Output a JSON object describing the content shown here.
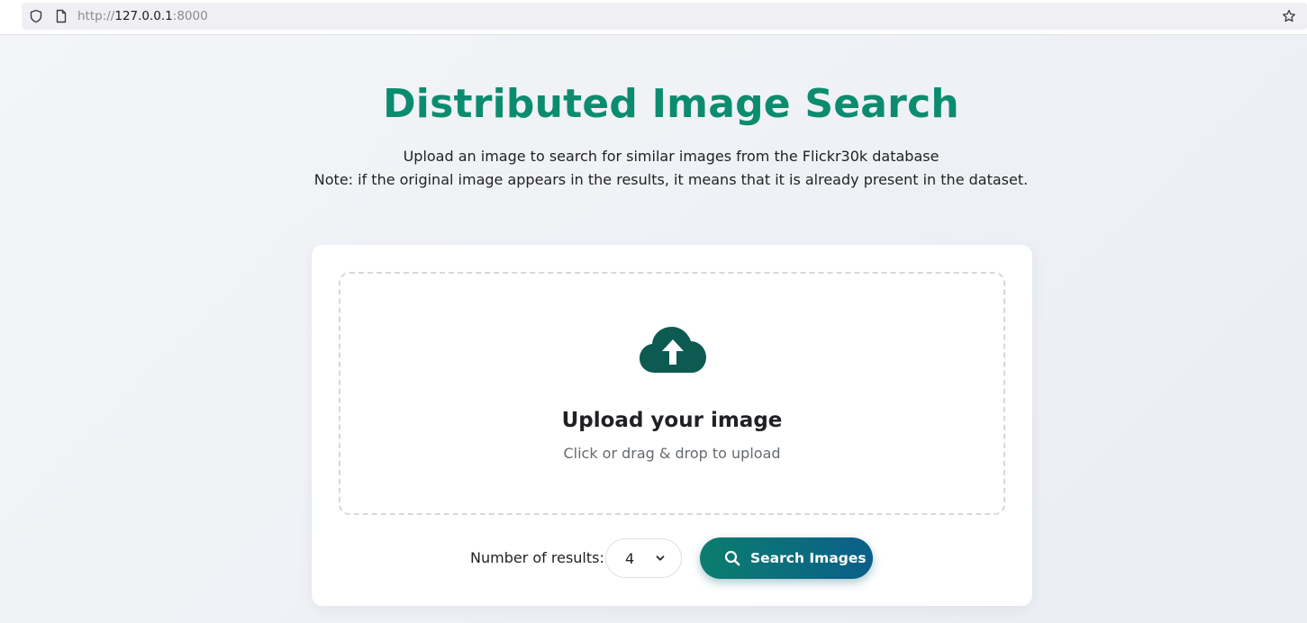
{
  "browser": {
    "url_scheme": "http://",
    "url_host": "127.0.0.1",
    "url_port": ":8000"
  },
  "header": {
    "title": "Distributed Image Search",
    "subtitle_line1": "Upload an image to search for similar images from the Flickr30k database",
    "subtitle_line2": "Note: if the original image appears in the results, it means that it is already present in the dataset."
  },
  "upload": {
    "icon": "cloud-upload-icon",
    "title": "Upload your image",
    "hint": "Click or drag & drop to upload"
  },
  "controls": {
    "results_label": "Number of results:",
    "results_value": "4",
    "search_button_label": "Search Images"
  },
  "colors": {
    "accent": "#0c8c6e",
    "button_start": "#0b7d6e",
    "button_end": "#0b5f8a",
    "icon_dark": "#0d5a52"
  }
}
